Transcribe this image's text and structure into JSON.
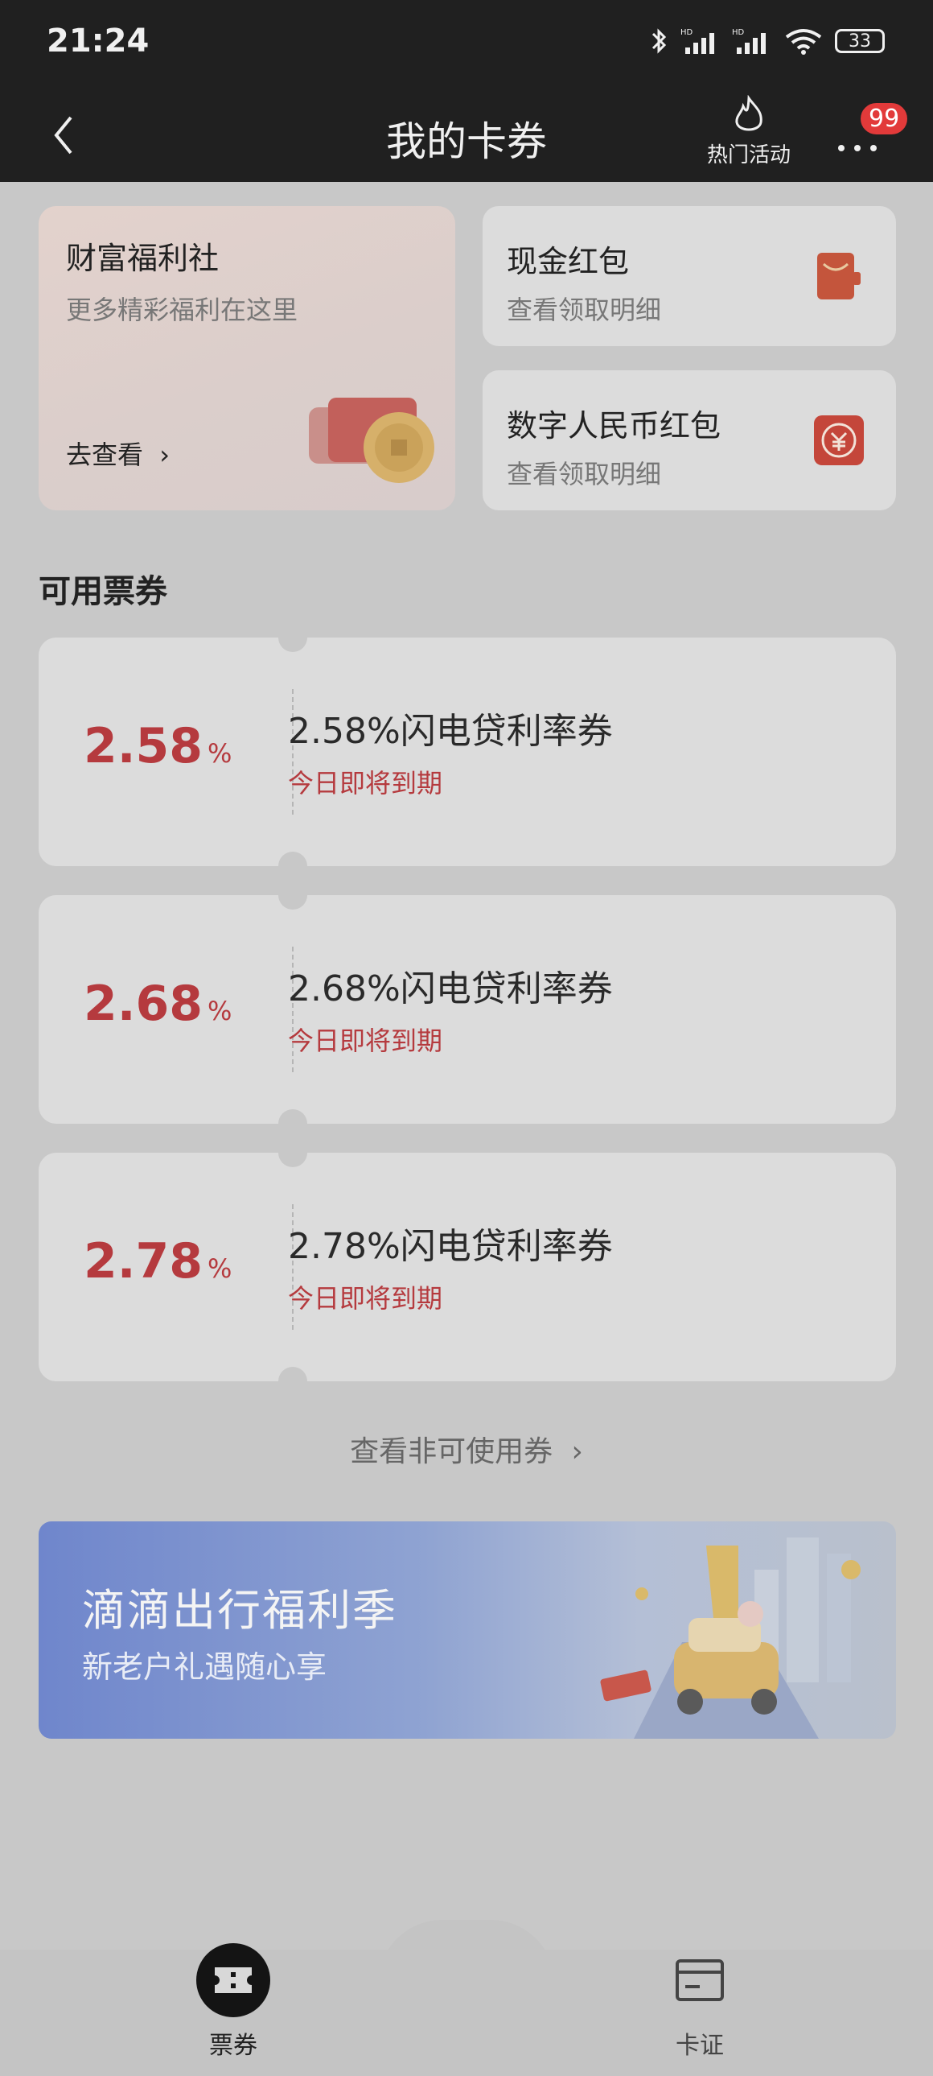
{
  "status": {
    "time": "21:24",
    "battery": "33"
  },
  "nav": {
    "title": "我的卡券",
    "hot_label": "热门活动",
    "badge": "99"
  },
  "welfare": {
    "title": "财富福利社",
    "subtitle": "更多精彩福利在这里",
    "link": "去查看"
  },
  "red_packet": {
    "title": "现金红包",
    "subtitle": "查看领取明细"
  },
  "digital_rmb": {
    "title": "数字人民币红包",
    "subtitle": "查看领取明细"
  },
  "section": {
    "title": "可用票券"
  },
  "coupons": [
    {
      "rate": "2.58",
      "unit": "%",
      "title": "2.58%闪电贷利率券",
      "status": "今日即将到期"
    },
    {
      "rate": "2.68",
      "unit": "%",
      "title": "2.68%闪电贷利率券",
      "status": "今日即将到期"
    },
    {
      "rate": "2.78",
      "unit": "%",
      "title": "2.78%闪电贷利率券",
      "status": "今日即将到期"
    }
  ],
  "view_unusable": "查看非可使用券",
  "banner": {
    "title": "滴滴出行福利季",
    "subtitle": "新老户礼遇随心享"
  },
  "tabs": {
    "coupon": "票券",
    "cert": "卡证"
  },
  "colors": {
    "accent_red": "#b53a3e",
    "dark_bar": "#202020",
    "badge_red": "#e23a3a"
  }
}
